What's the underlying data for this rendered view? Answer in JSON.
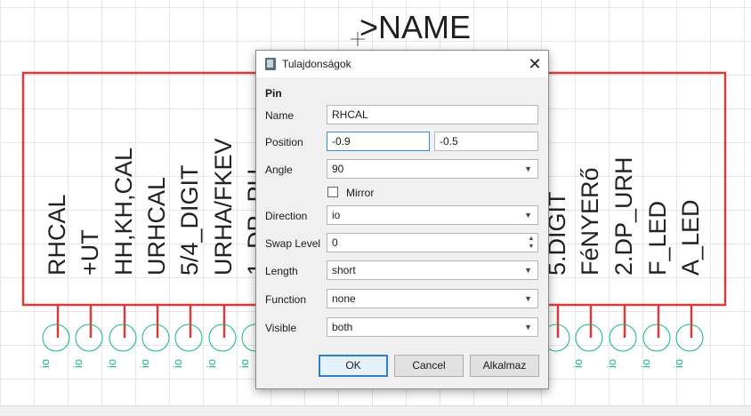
{
  "symbol": {
    "name_label": ">NAME",
    "left_pins": [
      "RHCAL",
      "+UT",
      "HH,KH,CAL",
      "URHCAL",
      "5/4_DIGIT",
      "URHA/FKEV",
      "1_DP_PU"
    ],
    "right_pins": [
      "5.DIGIT",
      "FéNYERő",
      "2.DP_URH",
      "F_LED",
      "A_LED"
    ],
    "pin_direction_label": "io"
  },
  "dialog": {
    "title": "Tulajdonságok",
    "close_glyph": "✕",
    "section": "Pin",
    "fields": {
      "name": {
        "label": "Name",
        "value": "RHCAL"
      },
      "position": {
        "label": "Position",
        "x": "-0.9",
        "y": "-0.5"
      },
      "angle": {
        "label": "Angle",
        "value": "90"
      },
      "mirror": {
        "label": "Mirror",
        "checked": false
      },
      "direction": {
        "label": "Direction",
        "value": "io"
      },
      "swap_level": {
        "label": "Swap Level",
        "value": "0"
      },
      "length": {
        "label": "Length",
        "value": "short"
      },
      "function": {
        "label": "Function",
        "value": "none"
      },
      "visible": {
        "label": "Visible",
        "value": "both"
      }
    },
    "buttons": {
      "ok": "OK",
      "cancel": "Cancel",
      "apply": "Alkalmaz"
    }
  },
  "colors": {
    "symbol_outline": "#d93b3b",
    "pin_label": "#12b886",
    "focus_border": "#3a88d8"
  },
  "icons": {
    "dialog_icon": "book-icon",
    "close": "close-icon",
    "combo": "chevron-down-icon"
  }
}
